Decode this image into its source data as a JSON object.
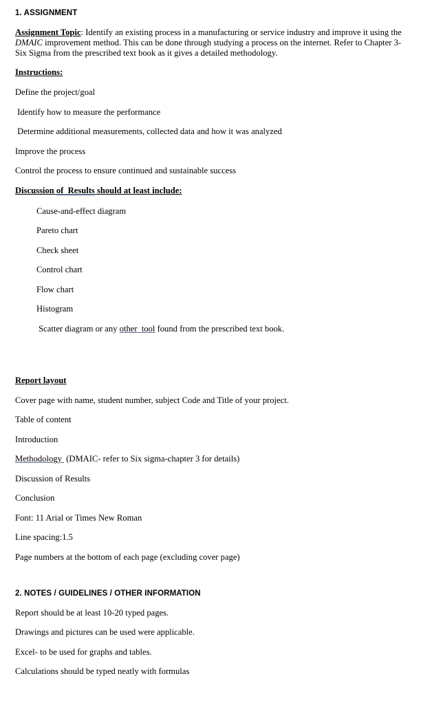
{
  "document": {
    "sections": [
      {
        "id": "assignment",
        "heading": "1. ASSIGNMENT",
        "topic_label": "Assignment Topic",
        "topic_sep": ": ",
        "topic_text_1": "Identify an existing process in a manufacturing or service industry and improve it using the ",
        "topic_emphasis": "DMAIC",
        "topic_text_2": " improvement method. This can be done through studying a process on the internet.  Refer to Chapter 3-Six Sigma from the prescribed text book as it gives a detailed methodology.",
        "instructions_label": "Instructions:",
        "instructions": [
          "Define the project/goal",
          " Identify how to measure the performance",
          " Determine additional measurements, collected data and how it was analyzed",
          "Improve the process",
          "Control the process to ensure continued and sustainable success"
        ],
        "discussion_label_1": "Discussion ",
        "discussion_label_2": "of  Results",
        "discussion_label_3": " should at least include:",
        "tools": [
          "Cause-and-effect diagram",
          "Pareto chart",
          "Check sheet",
          "Control chart",
          "Flow chart",
          "Histogram"
        ],
        "scatter_prefix": " Scatter diagram or any ",
        "scatter_link": "other  tool",
        "scatter_suffix": " found from the prescribed text book.",
        "report_layout_label": "Report layout",
        "report_layout_items": [
          "Cover page with name, student number, subject Code and Title of your project.",
          "Table of content",
          "Introduction"
        ],
        "methodology_label": "Methodology ",
        "methodology_rest": " (DMAIC- refer to Six sigma-chapter 3 for details)",
        "report_layout_items_2": [
          "Discussion of Results",
          "Conclusion",
          "Font: 11 Arial or Times New Roman",
          "Line spacing:1.5",
          "Page numbers at the bottom of each page (excluding cover page)"
        ]
      },
      {
        "id": "notes",
        "heading": "2. NOTES / GUIDELINES / OTHER INFORMATION",
        "notes": [
          "Report should be at least 10-20 typed pages.",
          "Drawings and pictures can be used were applicable.",
          "Excel- to be used for graphs and tables.",
          "Calculations should be typed neatly with formulas"
        ]
      }
    ]
  },
  "colors": {
    "text": "#000000",
    "background": "#ffffff",
    "grammar_underline": "#5d6f86"
  }
}
